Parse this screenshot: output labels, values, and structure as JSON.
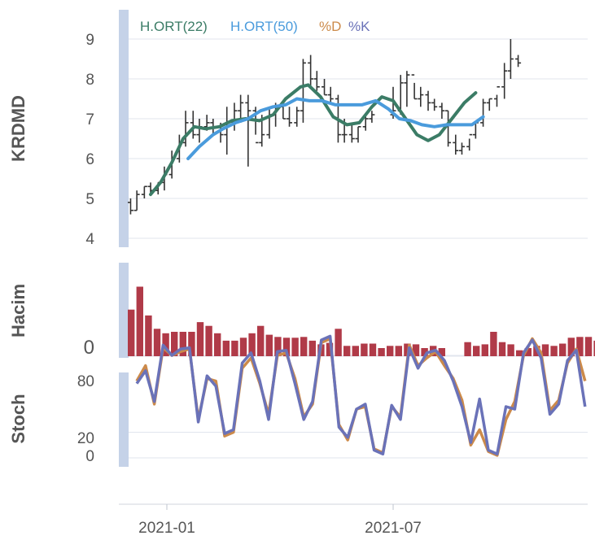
{
  "chart_data": [
    {
      "panel": "price",
      "type": "line",
      "ylabel": "KRDMD",
      "yticks": [
        4,
        5,
        6,
        7,
        8,
        9
      ],
      "ylim": [
        3.85,
        9.8
      ],
      "x_dates": [
        "2020-12-03",
        "2020-12-08",
        "2020-12-14",
        "2020-12-19",
        "2020-12-25",
        "2020-12-30",
        "2021-01-05",
        "2021-01-11",
        "2021-01-16",
        "2021-01-22",
        "2021-01-27",
        "2021-02-02",
        "2021-02-07",
        "2021-02-13",
        "2021-02-18",
        "2021-02-24",
        "2021-03-01",
        "2021-03-07",
        "2021-03-13",
        "2021-03-18",
        "2021-03-24",
        "2021-03-29",
        "2021-04-04",
        "2021-04-09",
        "2021-04-15",
        "2021-04-20",
        "2021-04-26",
        "2021-05-01",
        "2021-05-07",
        "2021-05-12",
        "2021-05-18",
        "2021-05-23",
        "2021-05-29",
        "2021-06-03",
        "2021-06-09",
        "2021-06-14",
        "2021-06-20",
        "2021-06-25",
        "2021-07-01",
        "2021-07-07",
        "2021-07-12",
        "2021-07-18",
        "2021-07-23",
        "2021-07-29",
        "2021-08-03",
        "2021-08-09",
        "2021-08-14",
        "2021-08-20",
        "2021-08-25",
        "2021-08-31",
        "2021-09-05",
        "2021-09-11",
        "2021-09-16",
        "2021-09-22",
        "2021-09-28",
        "2021-10-03",
        "2021-10-09",
        "2021-10-14",
        "2021-10-20",
        "2021-10-25",
        "2021-10-31",
        "2021-11-05",
        "2021-11-11",
        "2021-11-16",
        "2021-11-22",
        "2021-11-27",
        "2021-12-03",
        "2021-12-08"
      ],
      "series": [
        {
          "name": "OHLC",
          "kind": "ohlc",
          "open": [
            4.9,
            4.7,
            5.1,
            5.3,
            5.2,
            5.4,
            5.6,
            6.0,
            6.4,
            6.9,
            6.6,
            6.8,
            6.9,
            6.8,
            6.6,
            6.9,
            7.2,
            7.4,
            7.2,
            6.4,
            6.6,
            7.1,
            7.3,
            7.0,
            6.9,
            7.2,
            8.4,
            8.0,
            7.8,
            7.6,
            7.5,
            6.6,
            6.6,
            6.5,
            6.8,
            7.0,
            7.1,
            7.2,
            7.9,
            8.1,
            7.5,
            7.6,
            7.4,
            7.3,
            7.2,
            6.4,
            6.2,
            6.3,
            6.6,
            6.9,
            7.4,
            7.5,
            7.8,
            8.2,
            8.5
          ],
          "high": [
            5.0,
            5.2,
            5.3,
            5.4,
            5.4,
            5.8,
            6.2,
            6.6,
            7.2,
            7.2,
            7.0,
            7.1,
            7.0,
            6.9,
            7.3,
            7.4,
            7.6,
            7.6,
            7.3,
            7.1,
            7.3,
            7.4,
            7.4,
            7.3,
            7.3,
            8.5,
            8.6,
            8.2,
            8.0,
            7.8,
            7.6,
            7.0,
            6.9,
            6.8,
            7.1,
            7.2,
            7.8,
            8.1,
            8.2,
            7.9,
            7.8,
            7.7,
            7.5,
            7.4,
            7.2,
            6.6,
            6.4,
            6.5,
            6.9,
            7.5,
            7.5,
            7.6,
            8.4,
            9.0,
            8.6
          ],
          "low": [
            4.6,
            4.7,
            5.0,
            5.1,
            5.1,
            5.2,
            5.5,
            5.9,
            6.3,
            6.5,
            6.4,
            6.7,
            6.6,
            6.4,
            6.1,
            6.7,
            6.9,
            5.8,
            6.6,
            6.3,
            6.5,
            6.8,
            7.0,
            6.8,
            6.8,
            6.9,
            7.8,
            7.7,
            7.6,
            7.4,
            6.4,
            6.4,
            6.4,
            6.4,
            6.7,
            6.9,
            7.0,
            7.1,
            7.3,
            7.5,
            7.3,
            7.2,
            7.2,
            7.0,
            6.3,
            6.1,
            6.1,
            6.2,
            6.5,
            6.8,
            7.2,
            7.3,
            7.5,
            8.0,
            8.3
          ],
          "close": [
            4.7,
            5.1,
            5.3,
            5.2,
            5.4,
            5.6,
            6.0,
            6.4,
            6.9,
            6.6,
            6.8,
            6.9,
            6.8,
            6.6,
            6.9,
            7.2,
            7.4,
            7.2,
            6.4,
            6.6,
            7.1,
            7.3,
            7.0,
            6.9,
            7.2,
            8.4,
            8.0,
            7.8,
            7.6,
            7.5,
            6.6,
            6.6,
            6.5,
            6.8,
            7.0,
            7.1,
            7.2,
            7.9,
            8.1,
            7.5,
            7.6,
            7.4,
            7.3,
            7.2,
            6.4,
            6.2,
            6.3,
            6.6,
            6.9,
            7.4,
            7.5,
            7.8,
            8.2,
            8.5,
            8.4
          ],
          "x_index": [
            0,
            1,
            2,
            3,
            4,
            5,
            6,
            7,
            8,
            9,
            10,
            11,
            12,
            13,
            14,
            15,
            16,
            17,
            18,
            19,
            20,
            21,
            22,
            23,
            24,
            25,
            26,
            27,
            28,
            29,
            30,
            31,
            32,
            33,
            34,
            35,
            38,
            39,
            40,
            41,
            42,
            43,
            44,
            45,
            46,
            47,
            48,
            49,
            50,
            51,
            52,
            53,
            54,
            55,
            56
          ]
        },
        {
          "name": "H.ORT(22)",
          "color": "#3b7c66",
          "points": [
            [
              "2020-12-19",
              5.1
            ],
            [
              "2020-12-27",
              5.4
            ],
            [
              "2021-01-05",
              5.9
            ],
            [
              "2021-01-14",
              6.5
            ],
            [
              "2021-01-23",
              6.8
            ],
            [
              "2021-02-01",
              6.75
            ],
            [
              "2021-02-12",
              6.8
            ],
            [
              "2021-02-22",
              6.95
            ],
            [
              "2021-03-05",
              7.0
            ],
            [
              "2021-03-16",
              6.95
            ],
            [
              "2021-03-27",
              7.1
            ],
            [
              "2021-04-06",
              7.5
            ],
            [
              "2021-04-18",
              7.8
            ],
            [
              "2021-04-24",
              7.85
            ],
            [
              "2021-05-04",
              7.55
            ],
            [
              "2021-05-14",
              7.05
            ],
            [
              "2021-05-25",
              6.85
            ],
            [
              "2021-06-04",
              6.9
            ],
            [
              "2021-06-14",
              7.3
            ],
            [
              "2021-06-22",
              7.55
            ],
            [
              "2021-07-01",
              7.45
            ],
            [
              "2021-07-10",
              7.05
            ],
            [
              "2021-07-20",
              6.6
            ],
            [
              "2021-07-29",
              6.45
            ],
            [
              "2021-08-07",
              6.6
            ],
            [
              "2021-08-17",
              7.0
            ],
            [
              "2021-08-27",
              7.4
            ],
            [
              "2021-09-05",
              7.65
            ]
          ]
        },
        {
          "name": "H.ORT(50)",
          "color": "#4a9bdc",
          "points": [
            [
              "2021-01-18",
              6.0
            ],
            [
              "2021-01-27",
              6.3
            ],
            [
              "2021-02-07",
              6.6
            ],
            [
              "2021-02-15",
              6.75
            ],
            [
              "2021-02-25",
              6.9
            ],
            [
              "2021-03-07",
              7.0
            ],
            [
              "2021-03-17",
              7.2
            ],
            [
              "2021-03-27",
              7.3
            ],
            [
              "2021-04-06",
              7.35
            ],
            [
              "2021-04-15",
              7.5
            ],
            [
              "2021-04-25",
              7.45
            ],
            [
              "2021-05-05",
              7.45
            ],
            [
              "2021-05-16",
              7.35
            ],
            [
              "2021-05-27",
              7.35
            ],
            [
              "2021-06-06",
              7.35
            ],
            [
              "2021-06-17",
              7.45
            ],
            [
              "2021-06-27",
              7.25
            ],
            [
              "2021-07-06",
              7.0
            ],
            [
              "2021-07-15",
              6.95
            ],
            [
              "2021-07-24",
              6.85
            ],
            [
              "2021-08-03",
              6.8
            ],
            [
              "2021-08-13",
              6.85
            ],
            [
              "2021-08-23",
              6.85
            ],
            [
              "2021-09-02",
              6.85
            ],
            [
              "2021-09-11",
              7.05
            ]
          ]
        }
      ],
      "legend": [
        "H.ORT(22)",
        "H.ORT(50)",
        "%D",
        "%K"
      ]
    },
    {
      "panel": "volume",
      "type": "bar",
      "ylabel": "Hacim",
      "yticks": [
        0
      ],
      "color": "#b03a48",
      "values": [
        0.63,
        0.94,
        0.55,
        0.37,
        0.31,
        0.33,
        0.33,
        0.33,
        0.46,
        0.41,
        0.31,
        0.21,
        0.21,
        0.25,
        0.31,
        0.41,
        0.29,
        0.26,
        0.25,
        0.25,
        0.26,
        0.21,
        0.16,
        0.18,
        0.37,
        0.14,
        0.14,
        0.17,
        0.17,
        0.11,
        0.14,
        0.14,
        0.17,
        0.16,
        0.11,
        0.14,
        0.11,
        0,
        0,
        0.19,
        0.14,
        0.16,
        0.33,
        0.19,
        0.16,
        0.08,
        0.11,
        0.14,
        0.16,
        0.14,
        0.17,
        0.25,
        0.26,
        0.26,
        0.21,
        0.17,
        0.31,
        0.55,
        0.09
      ]
    },
    {
      "panel": "stochastic",
      "type": "line",
      "ylabel": "Stoch",
      "yticks": [
        0,
        20,
        80
      ],
      "series": [
        {
          "name": "%D",
          "color": "#cc8a4a",
          "values": [
            60,
            72,
            42,
            86,
            80,
            83,
            85,
            30,
            62,
            60,
            17,
            20,
            70,
            78,
            58,
            34,
            80,
            82,
            62,
            32,
            42,
            90,
            93,
            26,
            14,
            38,
            40,
            7,
            4,
            40,
            32,
            88,
            72,
            78,
            83,
            72,
            62,
            45,
            10,
            22,
            5,
            2,
            30,
            44,
            80,
            93,
            82,
            37,
            45,
            74,
            85,
            60
          ]
        },
        {
          "name": "%K",
          "color": "#6a72b8",
          "values": [
            58,
            68,
            44,
            88,
            80,
            85,
            86,
            28,
            64,
            56,
            19,
            22,
            74,
            82,
            60,
            30,
            83,
            84,
            58,
            30,
            44,
            92,
            95,
            24,
            16,
            38,
            42,
            6,
            3,
            41,
            30,
            86,
            70,
            82,
            84,
            76,
            60,
            40,
            12,
            46,
            6,
            3,
            40,
            38,
            82,
            92,
            78,
            34,
            42,
            76,
            84,
            40
          ]
        }
      ]
    }
  ],
  "x_axis": {
    "tick_labels": [
      "2021-01",
      "2021-07"
    ]
  }
}
